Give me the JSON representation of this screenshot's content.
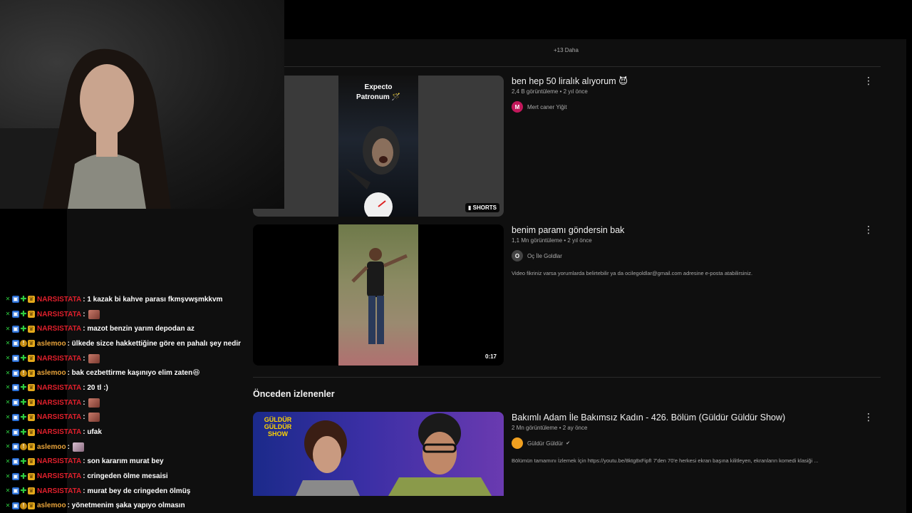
{
  "youtube": {
    "more_label": "+13 Daha",
    "videos": [
      {
        "title": "ben hep 50 liralık alıyorum 😈",
        "meta": "2,4 B görüntüleme • 2 yıl önce",
        "channel": "Mert caner Yiğit",
        "channel_initial": "M",
        "badge": "SHORTS",
        "thumb_text": "Expecto Patronum 🪄",
        "description": ""
      },
      {
        "title": "benim paramı göndersin bak",
        "meta": "1,1 Mn görüntüleme • 2 yıl önce",
        "channel": "Oç İle Goldlar",
        "channel_initial": "O",
        "badge": "0:17",
        "description": "Video fikriniz varsa yorumlarda belirtebilir ya da ocilegoldlar@gmail.com adresine e-posta atabilirsiniz."
      }
    ],
    "section_title": "Önceden izlenenler",
    "history": [
      {
        "title": "Bakımlı Adam İle Bakımsız Kadın - 426. Bölüm (Güldür Güldür Show)",
        "meta": "2 Mn görüntüleme • 2 ay önce",
        "channel": "Güldür Güldür",
        "verified": "✔",
        "thumb_logo": "GÜLDÜR GÜLDÜR SHOW",
        "description": "Bölümün tamamını İzlemek İçin https://youtu.be/8ktg8xFipfI 7'den 70'e herkesi ekran başına kilitleyen, ekranların komedi klasiği ..."
      }
    ]
  },
  "chat": {
    "colors": {
      "narsistata": "#e0202c",
      "aslemoo": "#e8a33a"
    },
    "messages": [
      {
        "user": "NARSISTATA",
        "badge_set": "plus",
        "text": ": 1 kazak bi kahve parası fkmşvwşmkkvm",
        "emote": ""
      },
      {
        "user": "NARSISTATA",
        "badge_set": "plus",
        "text": ":",
        "emote": "pepe"
      },
      {
        "user": "NARSISTATA",
        "badge_set": "plus",
        "text": ": mazot benzin yarım depodan az",
        "emote": ""
      },
      {
        "user": "aslemoo",
        "badge_set": "gold",
        "text": ": ülkede sizce hakkettiğine göre en pahalı şey nedir",
        "emote": ""
      },
      {
        "user": "NARSISTATA",
        "badge_set": "plus",
        "text": ":",
        "emote": "pepe"
      },
      {
        "user": "aslemoo",
        "badge_set": "gold",
        "text": ": bak cezbettirme kaşınıyo elim zaten😆",
        "emote": ""
      },
      {
        "user": "NARSISTATA",
        "badge_set": "plus",
        "text": ": 20 tl :)",
        "emote": ""
      },
      {
        "user": "NARSISTATA",
        "badge_set": "plus",
        "text": ":",
        "emote": "pepe"
      },
      {
        "user": "NARSISTATA",
        "badge_set": "plus",
        "text": ":",
        "emote": "pepe"
      },
      {
        "user": "NARSISTATA",
        "badge_set": "plus",
        "text": ": ufak",
        "emote": ""
      },
      {
        "user": "aslemoo",
        "badge_set": "gold",
        "text": ":",
        "emote": "cat"
      },
      {
        "user": "NARSISTATA",
        "badge_set": "plus",
        "text": ": son kararım murat bey",
        "emote": ""
      },
      {
        "user": "NARSISTATA",
        "badge_set": "plus",
        "text": ": cringeden ölme mesaisi",
        "emote": ""
      },
      {
        "user": "NARSISTATA",
        "badge_set": "plus",
        "text": ": murat bey de cringeden ölmüş",
        "emote": ""
      },
      {
        "user": "aslemoo",
        "badge_set": "gold",
        "text": ": yönetmenim şaka yapıyo olmasın",
        "emote": ""
      }
    ]
  }
}
